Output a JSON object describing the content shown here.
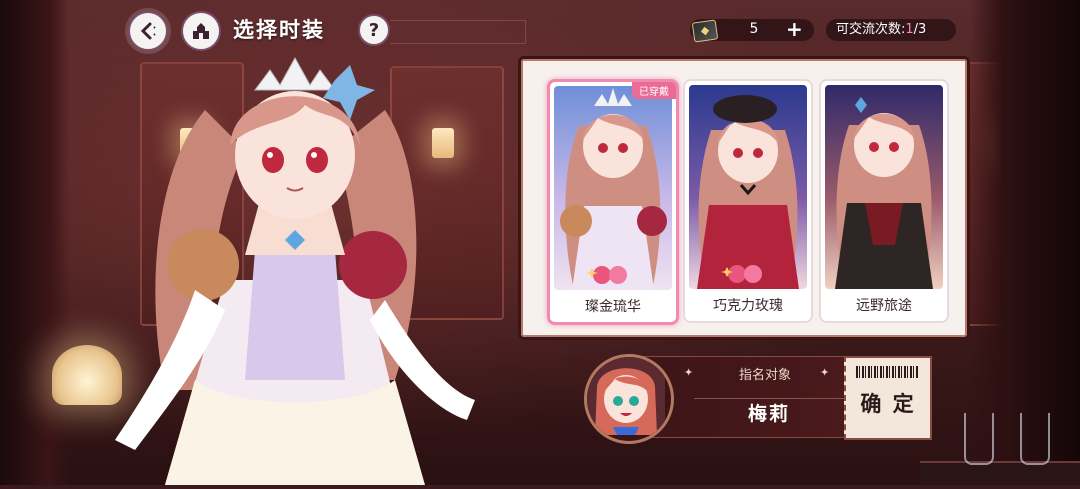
{
  "header": {
    "title": "选择时装",
    "help_label": "?",
    "currency_value": "5",
    "currency_icon": "ticket-icon",
    "exchange_label": "可交流次数:",
    "exchange_current": "1",
    "exchange_total": "/3"
  },
  "outfits": [
    {
      "name": "璨金琉华",
      "badge": "已穿戴",
      "selected": true
    },
    {
      "name": "巧克力玫瑰",
      "selected": false
    },
    {
      "name": "远野旅途",
      "selected": false
    }
  ],
  "designate": {
    "label": "指名对象",
    "name": "梅莉",
    "confirm_label": "确 定"
  },
  "colors": {
    "accent_pink": "#e96b96",
    "panel_bg": "#f7f1ee",
    "dark_red": "#3b1417"
  }
}
